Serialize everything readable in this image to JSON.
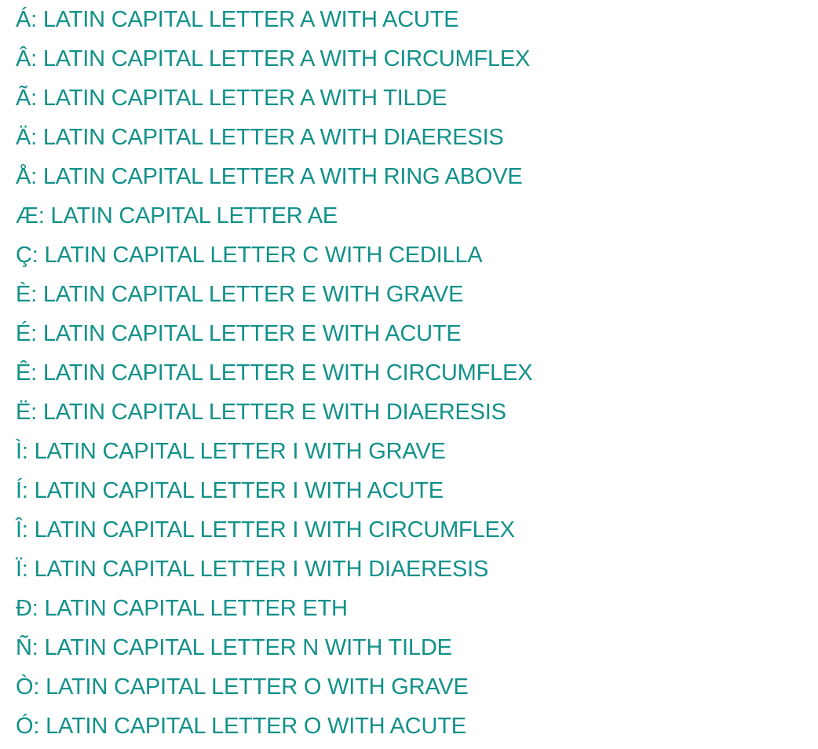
{
  "theme": {
    "text_color": "#12918A",
    "background": "#ffffff"
  },
  "characters": [
    {
      "glyph": "Á",
      "name": "LATIN CAPITAL LETTER A WITH ACUTE"
    },
    {
      "glyph": "Â",
      "name": "LATIN CAPITAL LETTER A WITH CIRCUMFLEX"
    },
    {
      "glyph": "Ã",
      "name": "LATIN CAPITAL LETTER A WITH TILDE"
    },
    {
      "glyph": "Ä",
      "name": "LATIN CAPITAL LETTER A WITH DIAERESIS"
    },
    {
      "glyph": "Å",
      "name": "LATIN CAPITAL LETTER A WITH RING ABOVE"
    },
    {
      "glyph": "Æ",
      "name": "LATIN CAPITAL LETTER AE"
    },
    {
      "glyph": "Ç",
      "name": "LATIN CAPITAL LETTER C WITH CEDILLA"
    },
    {
      "glyph": "È",
      "name": "LATIN CAPITAL LETTER E WITH GRAVE"
    },
    {
      "glyph": "É",
      "name": "LATIN CAPITAL LETTER E WITH ACUTE"
    },
    {
      "glyph": "Ê",
      "name": "LATIN CAPITAL LETTER E WITH CIRCUMFLEX"
    },
    {
      "glyph": "Ë",
      "name": "LATIN CAPITAL LETTER E WITH DIAERESIS"
    },
    {
      "glyph": "Ì",
      "name": "LATIN CAPITAL LETTER I WITH GRAVE"
    },
    {
      "glyph": "Í",
      "name": "LATIN CAPITAL LETTER I WITH ACUTE"
    },
    {
      "glyph": "Î",
      "name": "LATIN CAPITAL LETTER I WITH CIRCUMFLEX"
    },
    {
      "glyph": "Ï",
      "name": "LATIN CAPITAL LETTER I WITH DIAERESIS"
    },
    {
      "glyph": "Ð",
      "name": "LATIN CAPITAL LETTER ETH"
    },
    {
      "glyph": "Ñ",
      "name": "LATIN CAPITAL LETTER N WITH TILDE"
    },
    {
      "glyph": "Ò",
      "name": "LATIN CAPITAL LETTER O WITH GRAVE"
    },
    {
      "glyph": "Ó",
      "name": "LATIN CAPITAL LETTER O WITH ACUTE"
    }
  ]
}
